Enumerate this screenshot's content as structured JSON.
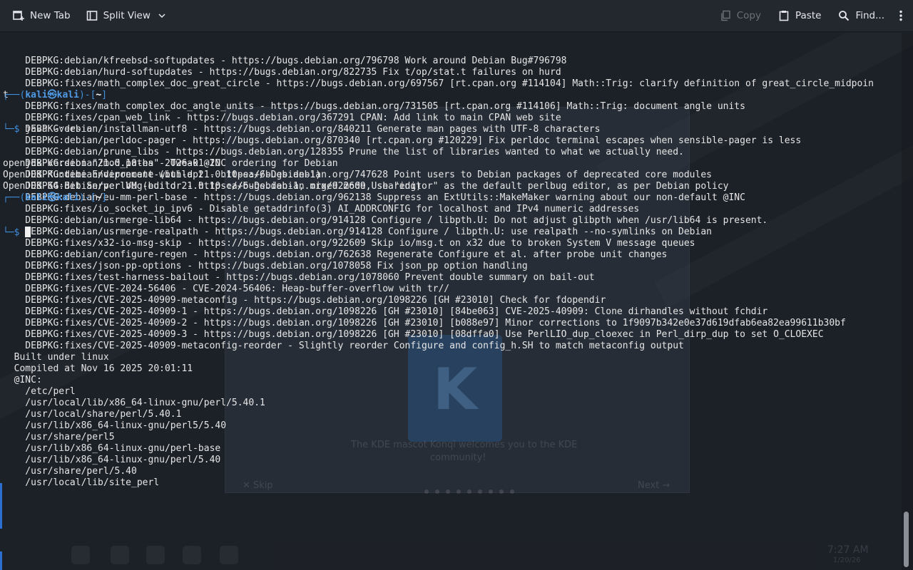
{
  "toolbar": {
    "new_tab": "New Tab",
    "split_view": "Split View",
    "copy": "Copy",
    "paste": "Paste",
    "find": "Find..."
  },
  "background": {
    "welcome_text_line1": "The KDE mascot Konqi welcomes you to the KDE",
    "welcome_text_line2": "community!",
    "skip": "✕ Skip",
    "next": "Next →",
    "logo_letter": "K",
    "clock_time": "7:27 AM",
    "clock_date": "1/20/26"
  },
  "terminal": {
    "output_lines": [
      "    DEBPKG:debian/kfreebsd-softupdates - https://bugs.debian.org/796798 Work around Debian Bug#796798",
      "    DEBPKG:debian/hurd-softupdates - https://bugs.debian.org/822735 Fix t/op/stat.t failures on hurd",
      "    DEBPKG:fixes/math_complex_doc_great_circle - https://bugs.debian.org/697567 [rt.cpan.org #114104] Math::Trig: clarify definition of great_circle_midpoin",
      "t",
      "    DEBPKG:fixes/math_complex_doc_angle_units - https://bugs.debian.org/731505 [rt.cpan.org #114106] Math::Trig: document angle units",
      "    DEBPKG:fixes/cpan_web_link - https://bugs.debian.org/367291 CPAN: Add link to main CPAN web site",
      "    DEBPKG:debian/installman-utf8 - https://bugs.debian.org/840211 Generate man pages with UTF-8 characters",
      "    DEBPKG:debian/perldoc-pager - https://bugs.debian.org/870340 [rt.cpan.org #120229] Fix perldoc terminal escapes when sensible-pager is less",
      "    DEBPKG:debian/prune_libs - https://bugs.debian.org/128355 Prune the list of libraries wanted to what we actually need.",
      "    DEBPKG:debian/mod_paths - Tweak @INC ordering for Debian",
      "    DEBPKG:debian/deprecate-with-apt - https://bugs.debian.org/747628 Point users to Debian packages of deprecated core modules",
      "    DEBPKG:debian/perlbug-editor - https://bugs.debian.org/922609 Use \"editor\" as the default perlbug editor, as per Debian policy",
      "    DEBPKG:debian/eu-mm-perl-base - https://bugs.debian.org/962138 Suppress an ExtUtils::MakeMaker warning about our non-default @INC",
      "    DEBPKG:fixes/io_socket_ip_ipv6 - Disable getaddrinfo(3) AI_ADDRCONFIG for localhost and IPv4 numeric addresses",
      "    DEBPKG:debian/usrmerge-lib64 - https://bugs.debian.org/914128 Configure / libpth.U: Do not adjust glibpth when /usr/lib64 is present.",
      "    DEBPKG:debian/usrmerge-realpath - https://bugs.debian.org/914128 Configure / libpth.U: use realpath --no-symlinks on Debian",
      "    DEBPKG:fixes/x32-io-msg-skip - https://bugs.debian.org/922609 Skip io/msg.t on x32 due to broken System V message queues",
      "    DEBPKG:debian/configure-regen - https://bugs.debian.org/762638 Regenerate Configure et al. after probe unit changes",
      "    DEBPKG:fixes/json-pp-options - https://bugs.debian.org/1078058 Fix json_pp option handling",
      "    DEBPKG:fixes/test-harness-bailout - https://bugs.debian.org/1078060 Prevent double summary on bail-out",
      "    DEBPKG:fixes/CVE-2024-56406 - CVE-2024-56406: Heap-buffer-overflow with tr//",
      "    DEBPKG:fixes/CVE-2025-40909-metaconfig - https://bugs.debian.org/1098226 [GH #23010] Check for fdopendir",
      "    DEBPKG:fixes/CVE-2025-40909-1 - https://bugs.debian.org/1098226 [GH #23010] [84be063] CVE-2025-40909: Clone dirhandles without fchdir",
      "    DEBPKG:fixes/CVE-2025-40909-2 - https://bugs.debian.org/1098226 [GH #23010] [b088e97] Minor corrections to 1f9097b342e0e37d619dfab6ea82ea99611b30bf",
      "    DEBPKG:fixes/CVE-2025-40909-3 - https://bugs.debian.org/1098226 [GH #23010] [08dffa0] Use PerlLIO_dup_cloexec in Perl_dirp_dup to set O_CLOEXEC",
      "    DEBPKG:fixes/CVE-2025-40909-metaconfig-reorder - Slightly reorder Configure and config_h.SH to match metaconfig output",
      "  Built under linux",
      "  Compiled at Nov 16 2025 20:01:11",
      "  @INC:",
      "    /etc/perl",
      "    /usr/local/lib/x86_64-linux-gnu/perl/5.40.1",
      "    /usr/local/share/perl/5.40.1",
      "    /usr/lib/x86_64-linux-gnu/perl5/5.40",
      "    /usr/share/perl5",
      "    /usr/lib/x86_64-linux-gnu/perl-base",
      "    /usr/lib/x86_64-linux-gnu/perl/5.40",
      "    /usr/share/perl/5.40",
      "    /usr/local/lib/site_perl",
      ""
    ],
    "prompt1": {
      "open": "┌──(",
      "user": "kali㉿kali",
      "mid": ")-[",
      "dir": "~",
      "close": "]",
      "dollar": "└─$ ",
      "command": "java -version"
    },
    "java_output": [
      "openjdk version \"21.0.10-ea\" 2026-01-20",
      "OpenJDK Runtime Environment (build 21.0.10-ea+6-Debian-1)",
      "OpenJDK 64-Bit Server VM (build 21.0.10-ea+6-Debian-1, mixed mode, sharing)",
      ""
    ],
    "prompt2": {
      "open": "┌──(",
      "user": "kali㉿kali",
      "mid": ")-[",
      "dir": "~",
      "close": "]",
      "dollar": "└─$ "
    }
  }
}
